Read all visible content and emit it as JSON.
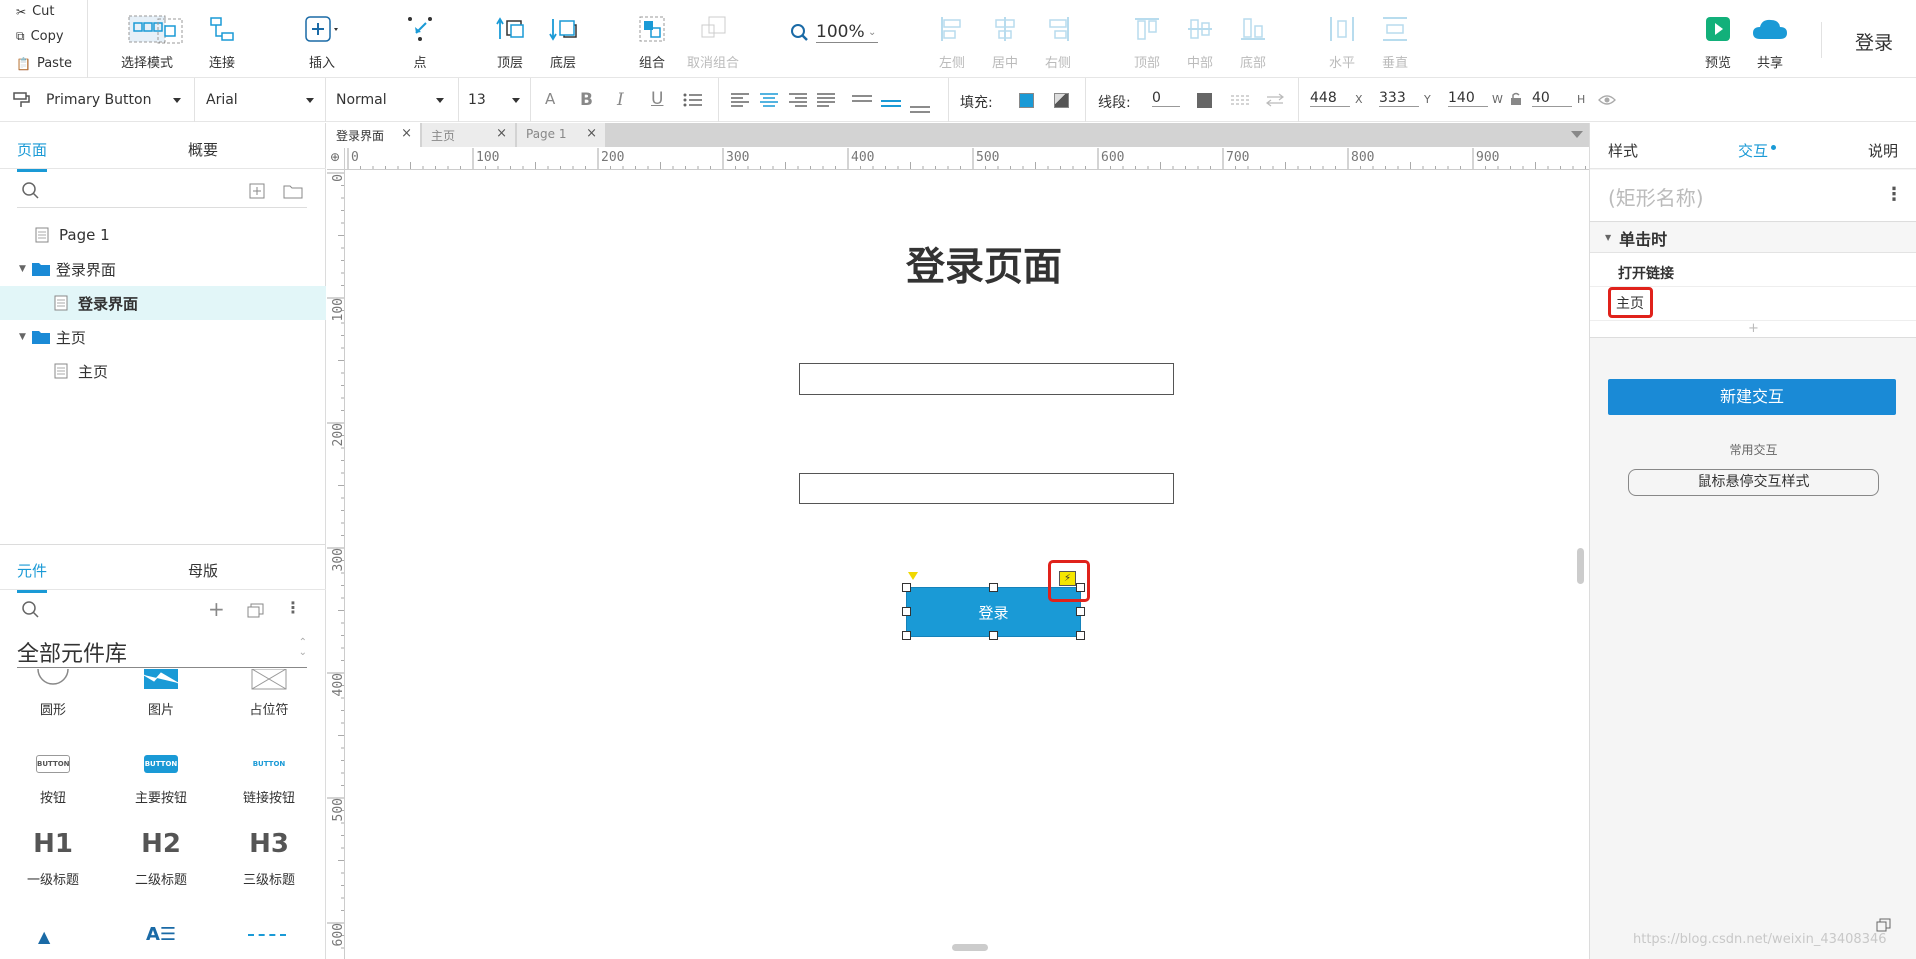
{
  "clipboard": {
    "cut": "Cut",
    "copy": "Copy",
    "paste": "Paste"
  },
  "toolbar": {
    "select_mode": "选择模式",
    "connect": "连接",
    "insert": "插入",
    "point": "点",
    "top_layer": "顶层",
    "bottom_layer": "底层",
    "group": "组合",
    "ungroup": "取消组合",
    "zoom": "100%",
    "align_left": "左侧",
    "align_center": "居中",
    "align_right": "右侧",
    "align_top": "顶部",
    "align_middle": "中部",
    "align_bottom": "底部",
    "dist_h": "水平",
    "dist_v": "垂直",
    "preview": "预览",
    "share": "共享",
    "login": "登录"
  },
  "format": {
    "style": "Primary Button",
    "font": "Arial",
    "weight": "Normal",
    "size": "13",
    "fill_label": "填充:",
    "stroke_label": "线段:",
    "stroke_value": "0",
    "x": "448",
    "x_label": "X",
    "y": "333",
    "y_label": "Y",
    "w": "140",
    "w_label": "W",
    "h": "40",
    "h_label": "H"
  },
  "left_panel": {
    "tabs": [
      "页面",
      "概要"
    ],
    "pages": [
      {
        "label": "Page 1",
        "type": "page"
      },
      {
        "label": "登录界面",
        "type": "folder"
      },
      {
        "label": "登录界面",
        "type": "page",
        "selected": true
      },
      {
        "label": "主页",
        "type": "folder"
      },
      {
        "label": "主页",
        "type": "page"
      }
    ],
    "lib_tabs": [
      "元件",
      "母版"
    ],
    "library_title": "全部元件库",
    "components": [
      {
        "label": "圆形",
        "icon": "circle"
      },
      {
        "label": "图片",
        "icon": "image"
      },
      {
        "label": "占位符",
        "icon": "placeholder"
      },
      {
        "label": "按钮",
        "icon": "button",
        "text": "BUTTON"
      },
      {
        "label": "主要按钮",
        "icon": "primary-button",
        "text": "BUTTON"
      },
      {
        "label": "链接按钮",
        "icon": "link-button",
        "text": "BUTTON"
      },
      {
        "label": "一级标题",
        "icon": "h1",
        "text": "H1"
      },
      {
        "label": "二级标题",
        "icon": "h2",
        "text": "H2"
      },
      {
        "label": "三级标题",
        "icon": "h3",
        "text": "H3"
      }
    ]
  },
  "doc_tabs": [
    "登录界面",
    "主页",
    "Page 1"
  ],
  "ruler": {
    "h": [
      "0",
      "100",
      "200",
      "300",
      "400",
      "500",
      "600",
      "700",
      "800",
      "900"
    ],
    "v": [
      "0",
      "100",
      "200",
      "300",
      "400",
      "500",
      "600"
    ]
  },
  "canvas": {
    "title": "登录页面",
    "button_label": "登录"
  },
  "right_panel": {
    "tabs": [
      "样式",
      "交互",
      "说明"
    ],
    "name_placeholder": "(矩形名称)",
    "event": "单击时",
    "action": "打开链接",
    "target": "主页",
    "plus": "+",
    "new_interaction": "新建交互",
    "common_label": "常用交互",
    "hover_style": "鼠标悬停交互样式"
  },
  "watermark": "https://blog.csdn.net/weixin_43408346",
  "colors": {
    "accent": "#1a9ad6",
    "highlight": "#e0221b"
  }
}
